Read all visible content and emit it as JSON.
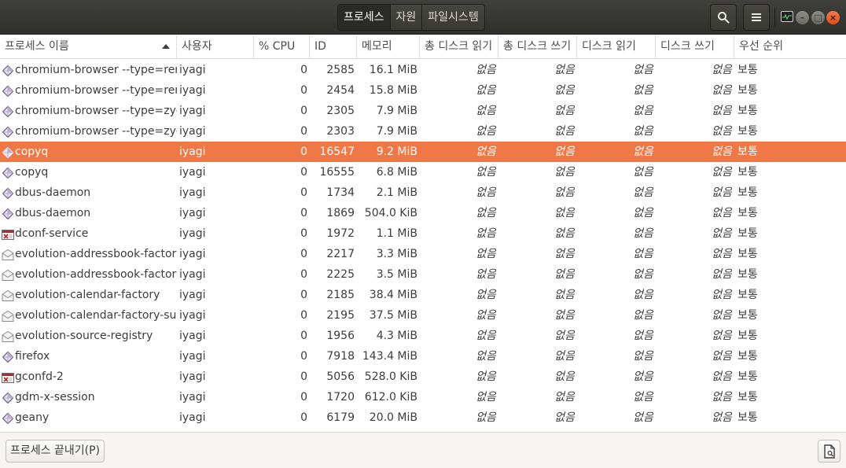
{
  "header": {
    "tabs": [
      {
        "label": "프로세스",
        "active": true
      },
      {
        "label": "자원",
        "active": false
      },
      {
        "label": "파일시스템",
        "active": false
      }
    ],
    "search_icon": "search-icon",
    "menu_icon": "hamburger-menu-icon",
    "window_buttons": [
      "minimize",
      "maximize",
      "close"
    ],
    "close_color": "#e95420"
  },
  "columns": {
    "name": "프로세스 이름",
    "user": "사용자",
    "cpu": "% CPU",
    "id": "ID",
    "memory": "메모리",
    "disk_read_total": "총 디스크 읽기",
    "disk_write_total": "총 디스크 쓰기",
    "disk_read": "디스크 읽기",
    "disk_write": "디스크 쓰기",
    "priority": "우선 순위"
  },
  "rows": [
    {
      "icon": "diamond",
      "name": "chromium-browser --type=renderer",
      "user": "iyagi",
      "cpu": "0",
      "id": "2585",
      "memory": "16.1 MiB",
      "disk_read_total": "없음",
      "disk_write_total": "없음",
      "disk_read": "없음",
      "disk_write": "없음",
      "priority": "보통",
      "selected": false
    },
    {
      "icon": "diamond",
      "name": "chromium-browser --type=renderer",
      "user": "iyagi",
      "cpu": "0",
      "id": "2454",
      "memory": "15.8 MiB",
      "disk_read_total": "없음",
      "disk_write_total": "없음",
      "disk_read": "없음",
      "disk_write": "없음",
      "priority": "보통",
      "selected": false
    },
    {
      "icon": "diamond",
      "name": "chromium-browser --type=zygote",
      "user": "iyagi",
      "cpu": "0",
      "id": "2305",
      "memory": "7.9 MiB",
      "disk_read_total": "없음",
      "disk_write_total": "없음",
      "disk_read": "없음",
      "disk_write": "없음",
      "priority": "보통",
      "selected": false
    },
    {
      "icon": "diamond",
      "name": "chromium-browser --type=zygote",
      "user": "iyagi",
      "cpu": "0",
      "id": "2303",
      "memory": "7.9 MiB",
      "disk_read_total": "없음",
      "disk_write_total": "없음",
      "disk_read": "없음",
      "disk_write": "없음",
      "priority": "보통",
      "selected": false
    },
    {
      "icon": "diamond",
      "name": "copyq",
      "user": "iyagi",
      "cpu": "0",
      "id": "16547",
      "memory": "9.2 MiB",
      "disk_read_total": "없음",
      "disk_write_total": "없음",
      "disk_read": "없음",
      "disk_write": "없음",
      "priority": "보통",
      "selected": true
    },
    {
      "icon": "diamond",
      "name": "copyq",
      "user": "iyagi",
      "cpu": "0",
      "id": "16555",
      "memory": "6.8 MiB",
      "disk_read_total": "없음",
      "disk_write_total": "없음",
      "disk_read": "없음",
      "disk_write": "없음",
      "priority": "보통",
      "selected": false
    },
    {
      "icon": "diamond",
      "name": "dbus-daemon",
      "user": "iyagi",
      "cpu": "0",
      "id": "1734",
      "memory": "2.1 MiB",
      "disk_read_total": "없음",
      "disk_write_total": "없음",
      "disk_read": "없음",
      "disk_write": "없음",
      "priority": "보통",
      "selected": false
    },
    {
      "icon": "diamond",
      "name": "dbus-daemon",
      "user": "iyagi",
      "cpu": "0",
      "id": "1869",
      "memory": "504.0 KiB",
      "disk_read_total": "없음",
      "disk_write_total": "없음",
      "disk_read": "없음",
      "disk_write": "없음",
      "priority": "보통",
      "selected": false
    },
    {
      "icon": "dconf",
      "name": "dconf-service",
      "user": "iyagi",
      "cpu": "0",
      "id": "1972",
      "memory": "1.1 MiB",
      "disk_read_total": "없음",
      "disk_write_total": "없음",
      "disk_read": "없음",
      "disk_write": "없음",
      "priority": "보통",
      "selected": false
    },
    {
      "icon": "envelope",
      "name": "evolution-addressbook-factory",
      "user": "iyagi",
      "cpu": "0",
      "id": "2217",
      "memory": "3.3 MiB",
      "disk_read_total": "없음",
      "disk_write_total": "없음",
      "disk_read": "없음",
      "disk_write": "없음",
      "priority": "보통",
      "selected": false
    },
    {
      "icon": "envelope",
      "name": "evolution-addressbook-factory",
      "user": "iyagi",
      "cpu": "0",
      "id": "2225",
      "memory": "3.5 MiB",
      "disk_read_total": "없음",
      "disk_write_total": "없음",
      "disk_read": "없음",
      "disk_write": "없음",
      "priority": "보통",
      "selected": false
    },
    {
      "icon": "envelope",
      "name": "evolution-calendar-factory",
      "user": "iyagi",
      "cpu": "0",
      "id": "2185",
      "memory": "38.4 MiB",
      "disk_read_total": "없음",
      "disk_write_total": "없음",
      "disk_read": "없음",
      "disk_write": "없음",
      "priority": "보통",
      "selected": false
    },
    {
      "icon": "envelope",
      "name": "evolution-calendar-factory-sub",
      "user": "iyagi",
      "cpu": "0",
      "id": "2195",
      "memory": "37.5 MiB",
      "disk_read_total": "없음",
      "disk_write_total": "없음",
      "disk_read": "없음",
      "disk_write": "없음",
      "priority": "보통",
      "selected": false
    },
    {
      "icon": "envelope",
      "name": "evolution-source-registry",
      "user": "iyagi",
      "cpu": "0",
      "id": "1956",
      "memory": "4.3 MiB",
      "disk_read_total": "없음",
      "disk_write_total": "없음",
      "disk_read": "없음",
      "disk_write": "없음",
      "priority": "보통",
      "selected": false
    },
    {
      "icon": "diamond",
      "name": "firefox",
      "user": "iyagi",
      "cpu": "0",
      "id": "7918",
      "memory": "143.4 MiB",
      "disk_read_total": "없음",
      "disk_write_total": "없음",
      "disk_read": "없음",
      "disk_write": "없음",
      "priority": "보통",
      "selected": false
    },
    {
      "icon": "dconf",
      "name": "gconfd-2",
      "user": "iyagi",
      "cpu": "0",
      "id": "5056",
      "memory": "528.0 KiB",
      "disk_read_total": "없음",
      "disk_write_total": "없음",
      "disk_read": "없음",
      "disk_write": "없음",
      "priority": "보통",
      "selected": false
    },
    {
      "icon": "diamond",
      "name": "gdm-x-session",
      "user": "iyagi",
      "cpu": "0",
      "id": "1720",
      "memory": "612.0 KiB",
      "disk_read_total": "없음",
      "disk_write_total": "없음",
      "disk_read": "없음",
      "disk_write": "없음",
      "priority": "보통",
      "selected": false
    },
    {
      "icon": "diamond",
      "name": "geany",
      "user": "iyagi",
      "cpu": "0",
      "id": "6179",
      "memory": "20.0 MiB",
      "disk_read_total": "없음",
      "disk_write_total": "없음",
      "disk_read": "없음",
      "disk_write": "없음",
      "priority": "보통",
      "selected": false
    }
  ],
  "footer": {
    "end_process_label": "프로세스 끝내기(P)",
    "properties_icon": "document-properties-icon"
  },
  "colors": {
    "selection": "#f07746",
    "headerbar": "#353532"
  }
}
